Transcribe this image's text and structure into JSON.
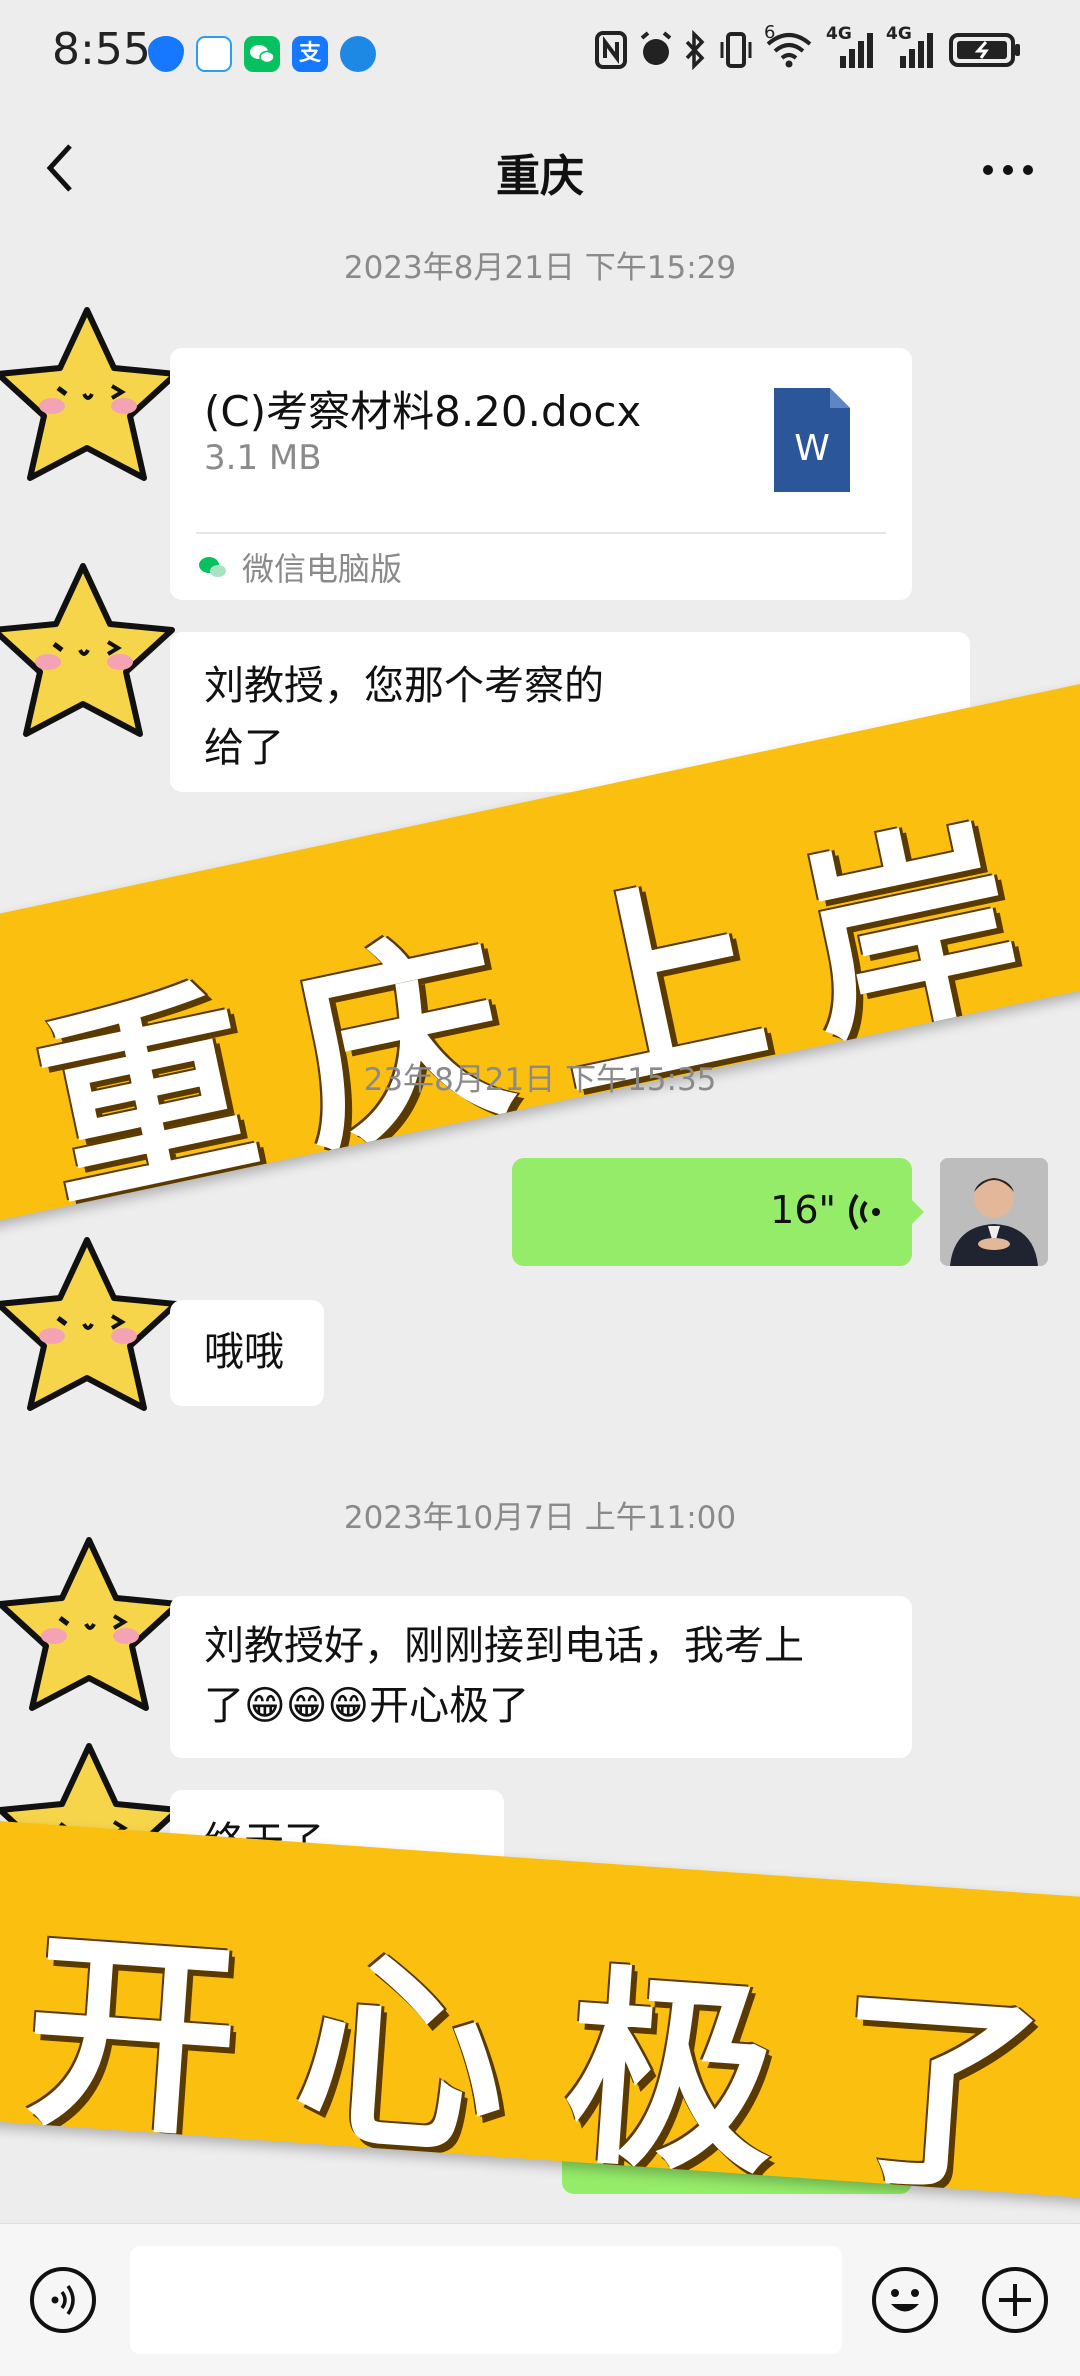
{
  "status_bar": {
    "time": "8:55",
    "app_icons": [
      "shield-app-icon",
      "qq-browser-icon",
      "wechat-icon",
      "alipay-icon",
      "browser-icon"
    ],
    "alipay_glyph": "支",
    "network_label_1": "6",
    "network_label_2": "4G",
    "network_label_3": "4G"
  },
  "header": {
    "title": "重庆"
  },
  "messages": {
    "ts1": "2023年8月21日 下午15:29",
    "file_name": "(C)考察材料8.20.docx",
    "file_size": "3.1 MB",
    "file_source": "微信电脑版",
    "file_icon_letter": "W",
    "msg2": "刘教授，您那个考察的",
    "msg2_line2": "给了",
    "ts2": "23年8月21日 下午15:35",
    "voice_duration": "16\"",
    "msg3": "哦哦",
    "ts3": "2023年10月7日 上午11:00",
    "msg4_line1": "刘教授好，刚刚接到电话，我考上",
    "msg4_line2": "了😁😁😁开心极了",
    "msg5": "终于了"
  },
  "banners": {
    "top": "重庆上岸",
    "bottom": "开心极了"
  },
  "colors": {
    "sent_bubble": "#95ec69",
    "banner_yellow": "#fbbf10",
    "background": "#ededed",
    "doc_blue": "#2b579a"
  }
}
